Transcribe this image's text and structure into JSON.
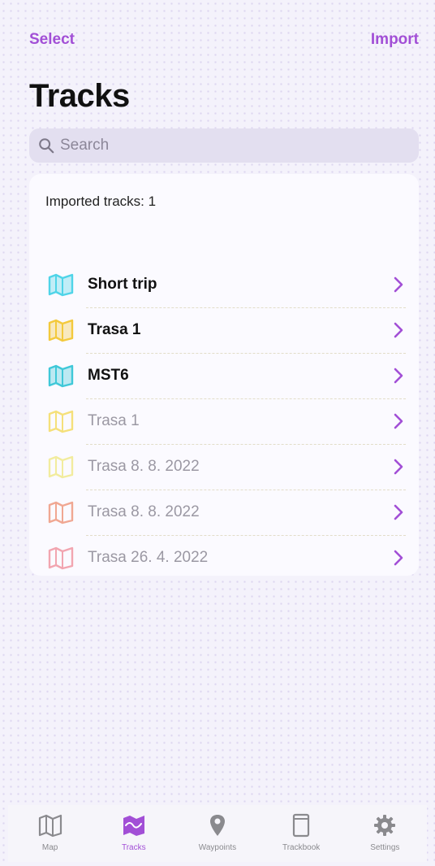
{
  "header": {
    "select_label": "Select",
    "import_label": "Import",
    "title": "Tracks"
  },
  "search": {
    "placeholder": "Search"
  },
  "summary": {
    "imported_text": "Imported tracks: 1"
  },
  "tracks": [
    {
      "name": "Short trip",
      "style": "bold",
      "icon": "map-icon",
      "color": "#4fd4e8"
    },
    {
      "name": "Trasa 1",
      "style": "bold",
      "icon": "map-icon",
      "color": "#f3c93c"
    },
    {
      "name": "MST6",
      "style": "bold",
      "icon": "map-icon",
      "color": "#3fc8d8"
    },
    {
      "name": "Trasa 1",
      "style": "dim",
      "icon": "map-icon",
      "color": "#f5e07a"
    },
    {
      "name": "Trasa 8. 8. 2022",
      "style": "dim",
      "icon": "map-icon",
      "color": "#f2ec9e"
    },
    {
      "name": "Trasa 8. 8. 2022",
      "style": "dim",
      "icon": "map-icon",
      "color": "#f0a792"
    },
    {
      "name": "Trasa 26. 4. 2022",
      "style": "dim",
      "icon": "map-icon",
      "color": "#f2a5b0"
    }
  ],
  "tabbar": {
    "accent": "#a24fd6",
    "tabs": [
      {
        "label": "Map",
        "icon": "map-icon",
        "active": false
      },
      {
        "label": "Tracks",
        "icon": "tracks-icon",
        "active": true
      },
      {
        "label": "Waypoints",
        "icon": "pin-icon",
        "active": false
      },
      {
        "label": "Trackbook",
        "icon": "book-icon",
        "active": false
      },
      {
        "label": "Settings",
        "icon": "gear-icon",
        "active": false
      }
    ]
  }
}
